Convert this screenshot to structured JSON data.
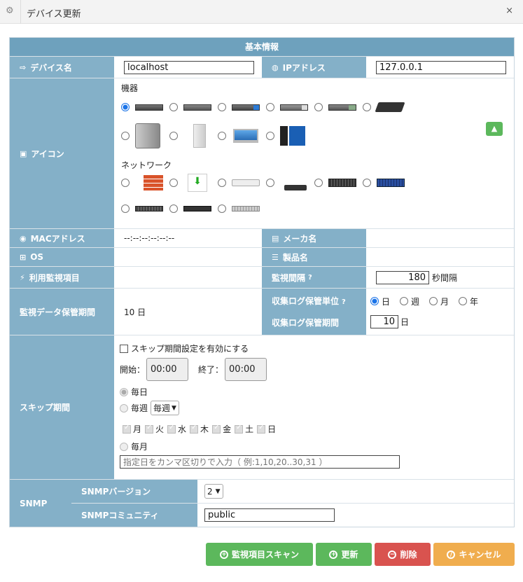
{
  "window": {
    "title": "デバイス更新",
    "close": "×"
  },
  "section_header": "基本情報",
  "device_name": {
    "label": "デバイス名",
    "value": "localhost"
  },
  "ip": {
    "label": "IPアドレス",
    "value": "127.0.0.1"
  },
  "icon": {
    "label": "アイコン",
    "group1": "機器",
    "group2": "ネットワーク"
  },
  "mac": {
    "label": "MACアドレス",
    "value": "--:--:--:--:--:--"
  },
  "maker": {
    "label": "メーカ名",
    "value": ""
  },
  "os": {
    "label": "OS",
    "value": ""
  },
  "product": {
    "label": "製品名",
    "value": ""
  },
  "monitors": {
    "label": "利用監視項目",
    "value": ""
  },
  "interval": {
    "label": "監視間隔",
    "value": "180",
    "unit": "秒間隔"
  },
  "retention": {
    "label": "監視データ保管期間",
    "value": "10 日"
  },
  "log_unit": {
    "label": "収集ログ保管単位",
    "options": [
      "日",
      "週",
      "月",
      "年"
    ],
    "selected": "日"
  },
  "log_period": {
    "label": "収集ログ保管期間",
    "value": "10",
    "unit": "日"
  },
  "skip": {
    "label": "スキップ期間",
    "enable": "スキップ期間設定を有効にする",
    "start_label": "開始：",
    "start": "00:00",
    "end_label": "終了：",
    "end": "00:00",
    "daily": "毎日",
    "weekly": "毎週",
    "weekly_select": "毎週",
    "days": [
      "月",
      "火",
      "水",
      "木",
      "金",
      "土",
      "日"
    ],
    "monthly": "毎月",
    "monthly_placeholder": "指定日をカンマ区切りで入力（ 例:1,10,20..30,31 ）"
  },
  "snmp": {
    "label": "SNMP",
    "version_label": "SNMPバージョン",
    "version": "2",
    "community_label": "SNMPコミュニティ",
    "community": "public"
  },
  "buttons": {
    "scan": "監視項目スキャン",
    "update": "更新",
    "delete": "削除",
    "cancel": "キャンセル"
  },
  "colors": {
    "header": "#6ea1bd",
    "label": "#84b0c8",
    "green": "#5cb85c",
    "red": "#d9534f",
    "orange": "#f0ad4e"
  }
}
